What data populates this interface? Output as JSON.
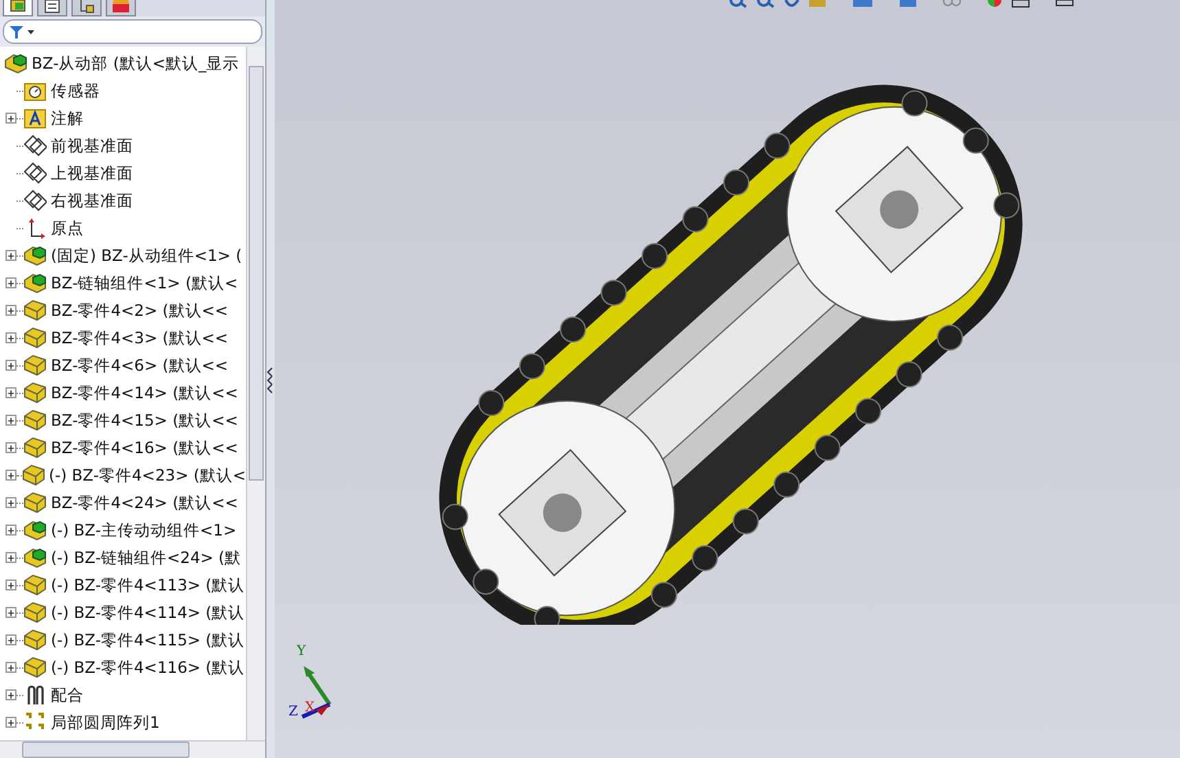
{
  "panel_tabs": [
    {
      "kind": "feature-tree",
      "selected": true
    },
    {
      "kind": "properties",
      "selected": false
    },
    {
      "kind": "configuration",
      "selected": false
    },
    {
      "kind": "display",
      "selected": false
    }
  ],
  "tree": {
    "label": "BZ-从动部  (默认<默认_显示",
    "kind": "assembly",
    "children": [
      {
        "label": "传感器",
        "kind": "sensor-folder",
        "expandable": false
      },
      {
        "label": "注解",
        "kind": "annotation-folder",
        "expandable": true
      },
      {
        "label": "前视基准面",
        "kind": "plane",
        "expandable": false
      },
      {
        "label": "上视基准面",
        "kind": "plane",
        "expandable": false
      },
      {
        "label": "右视基准面",
        "kind": "plane",
        "expandable": false
      },
      {
        "label": "原点",
        "kind": "origin",
        "expandable": false
      },
      {
        "label": "(固定) BZ-从动组件<1> (",
        "kind": "assembly",
        "expandable": true
      },
      {
        "label": "BZ-链轴组件<1> (默认<",
        "kind": "assembly",
        "expandable": true
      },
      {
        "label": "BZ-零件4<2> (默认<<",
        "kind": "part",
        "expandable": true
      },
      {
        "label": "BZ-零件4<3> (默认<<",
        "kind": "part",
        "expandable": true
      },
      {
        "label": "BZ-零件4<6> (默认<<",
        "kind": "part",
        "expandable": true
      },
      {
        "label": "BZ-零件4<14> (默认<<",
        "kind": "part",
        "expandable": true
      },
      {
        "label": "BZ-零件4<15> (默认<<",
        "kind": "part",
        "expandable": true
      },
      {
        "label": "BZ-零件4<16> (默认<<",
        "kind": "part",
        "expandable": true
      },
      {
        "label": "(-) BZ-零件4<23> (默认<",
        "kind": "part",
        "expandable": true
      },
      {
        "label": "BZ-零件4<24> (默认<<",
        "kind": "part",
        "expandable": true
      },
      {
        "label": "(-) BZ-主传动动组件<1>",
        "kind": "assembly",
        "expandable": true
      },
      {
        "label": "(-) BZ-链轴组件<24> (默",
        "kind": "assembly",
        "expandable": true
      },
      {
        "label": "(-) BZ-零件4<113> (默认",
        "kind": "part",
        "expandable": true
      },
      {
        "label": "(-) BZ-零件4<114> (默认",
        "kind": "part",
        "expandable": true
      },
      {
        "label": "(-) BZ-零件4<115> (默认",
        "kind": "part",
        "expandable": true
      },
      {
        "label": "(-) BZ-零件4<116> (默认",
        "kind": "part",
        "expandable": true
      },
      {
        "label": "配合",
        "kind": "mates",
        "expandable": true
      },
      {
        "label": "局部圆周阵列1",
        "kind": "pattern",
        "expandable": true
      }
    ]
  },
  "triad": {
    "x_label": "X",
    "y_label": "Y",
    "z_label": "Z"
  }
}
